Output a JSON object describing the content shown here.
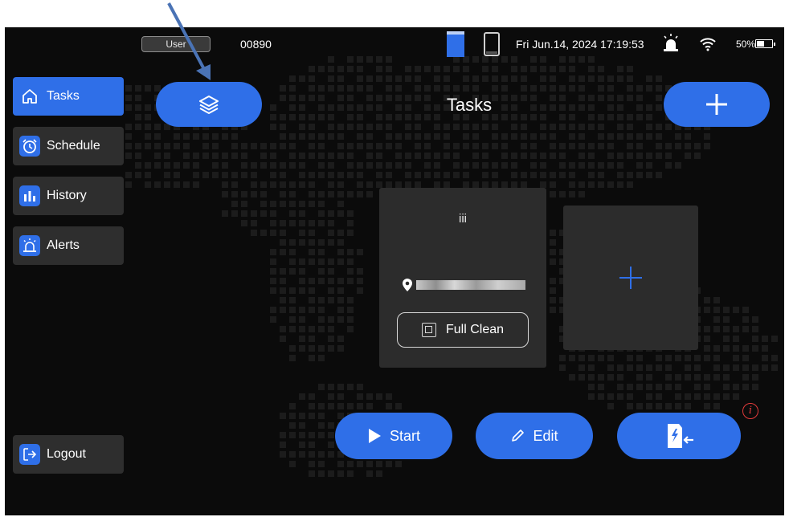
{
  "status_bar": {
    "user_label": "User",
    "user_id": "00890",
    "datetime": "Fri Jun.14, 2024 17:19:53",
    "battery_percent": "50%",
    "battery_level": 0.5
  },
  "sidebar": {
    "items": [
      {
        "label": "Tasks",
        "icon": "home-icon",
        "active": true
      },
      {
        "label": "Schedule",
        "icon": "alarm-clock-icon",
        "active": false
      },
      {
        "label": "History",
        "icon": "bar-chart-icon",
        "active": false
      },
      {
        "label": "Alerts",
        "icon": "siren-icon",
        "active": false
      }
    ],
    "logout_label": "Logout"
  },
  "header": {
    "title": "Tasks"
  },
  "task_card": {
    "title": "iii",
    "mode_label": "Full Clean"
  },
  "actions": {
    "start_label": "Start",
    "edit_label": "Edit"
  },
  "colors": {
    "accent": "#2f6fe8",
    "card": "#2c2c2c",
    "background": "#0b0b0b",
    "alert": "#e03a3a"
  }
}
